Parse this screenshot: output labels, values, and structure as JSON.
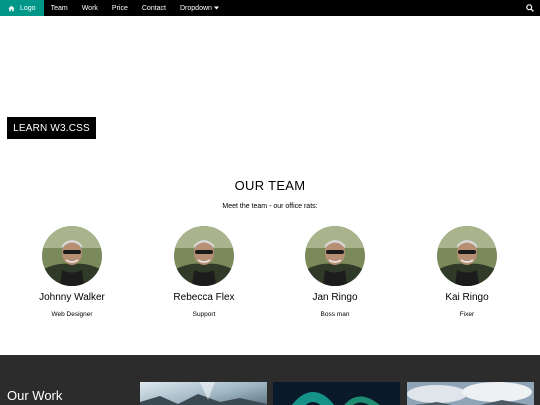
{
  "nav": {
    "logo_label": "Logo",
    "items": [
      "Team",
      "Work",
      "Price",
      "Contact"
    ],
    "dropdown_label": "Dropdown",
    "active_color": "#009688"
  },
  "hero": {
    "button_label": "LEARN W3.CSS"
  },
  "team": {
    "title": "OUR TEAM",
    "subtitle": "Meet the team - our office rats:",
    "members": [
      {
        "name": "Johnny Walker",
        "role": "Web Designer"
      },
      {
        "name": "Rebecca Flex",
        "role": "Support"
      },
      {
        "name": "Jan Ringo",
        "role": "Boss man"
      },
      {
        "name": "Kai Ringo",
        "role": "Fixer"
      }
    ]
  },
  "work": {
    "title": "Our Work"
  }
}
